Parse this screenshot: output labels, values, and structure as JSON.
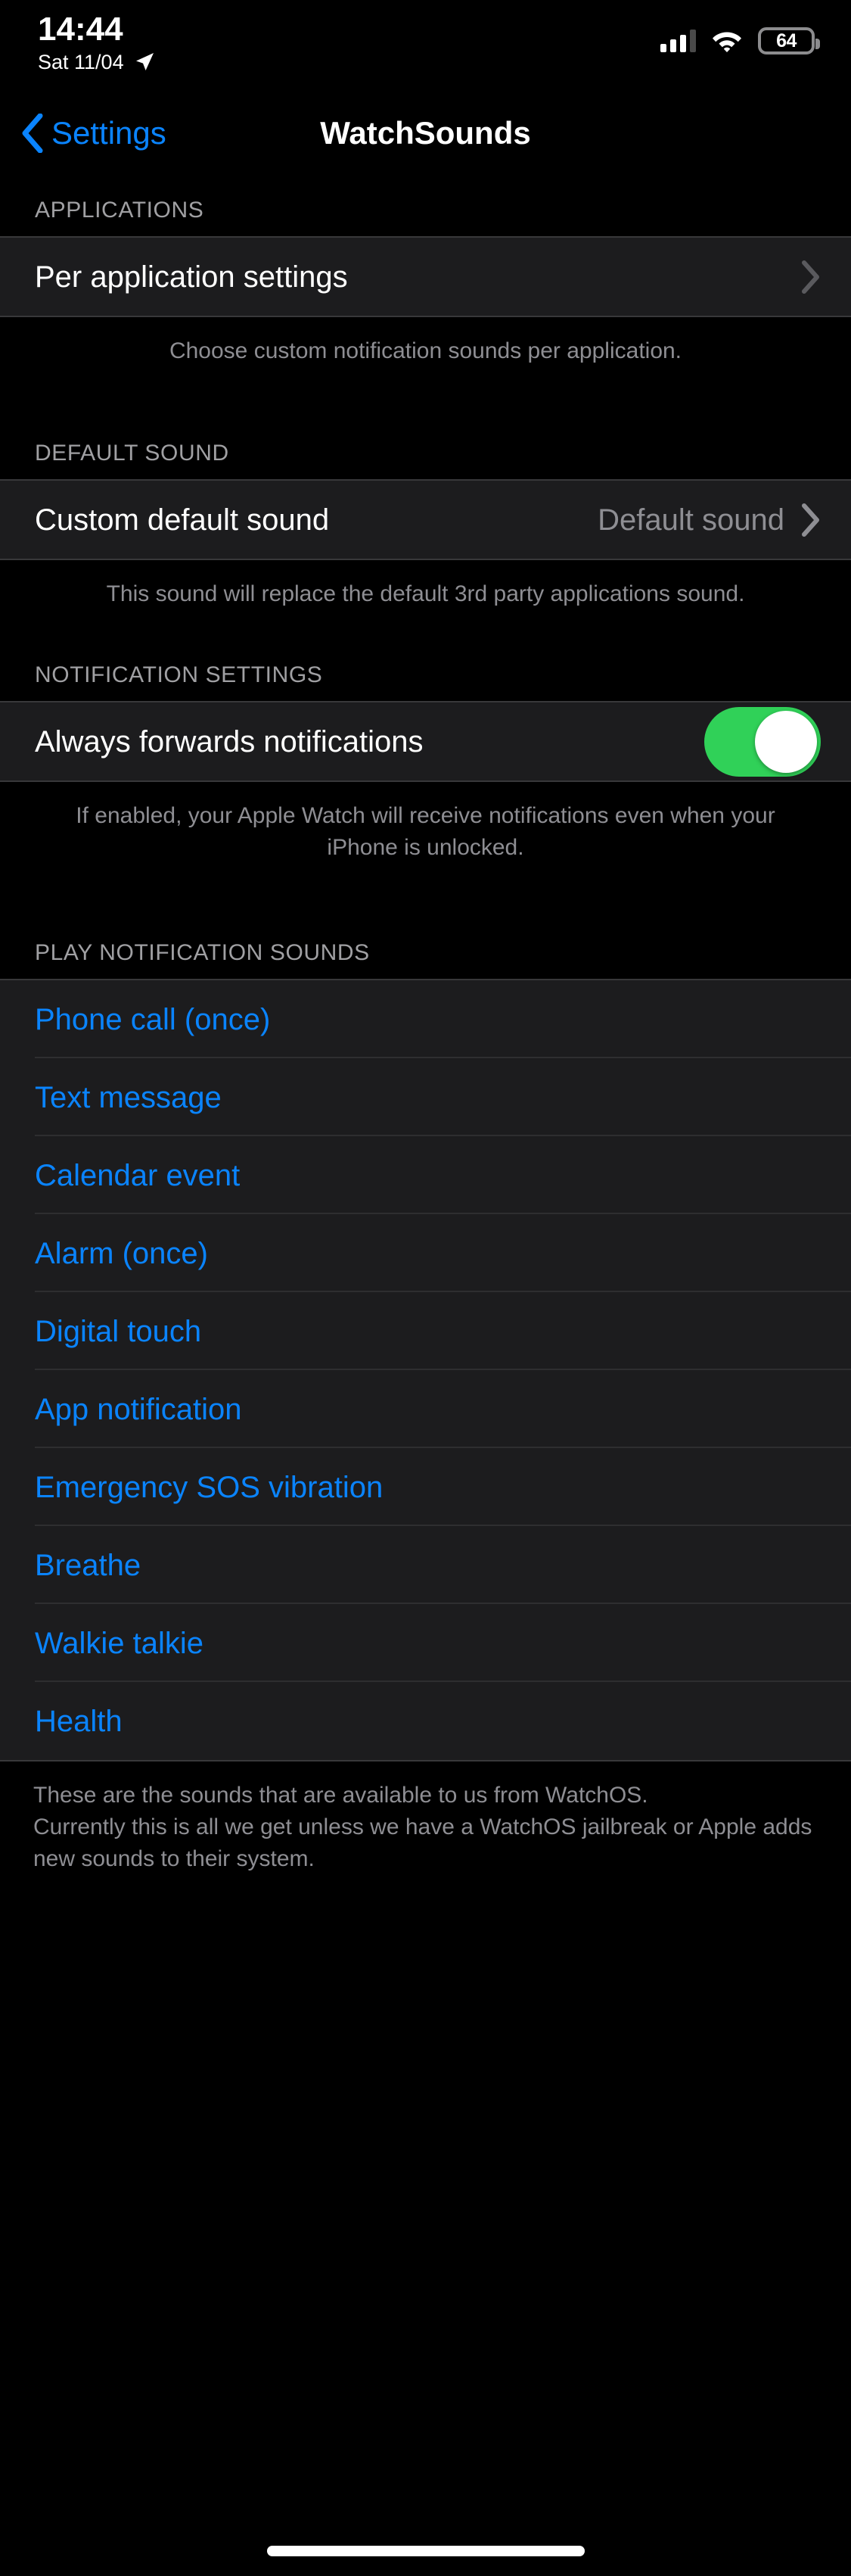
{
  "status_bar": {
    "time": "14:44",
    "date": "Sat 11/04",
    "location_icon": "location-arrow-icon",
    "cellular_icon": "cellular-signal-icon",
    "wifi_icon": "wifi-icon",
    "battery_percent": "64"
  },
  "nav": {
    "back_label": "Settings",
    "back_icon": "chevron-left-icon",
    "title": "WatchSounds"
  },
  "sections": {
    "applications": {
      "header": "APPLICATIONS",
      "row_label": "Per application settings",
      "footer": "Choose custom notification sounds per application."
    },
    "default_sound": {
      "header": "DEFAULT SOUND",
      "row_label": "Custom default sound",
      "row_value": "Default sound",
      "footer": "This sound will replace the default 3rd party applications sound."
    },
    "notification_settings": {
      "header": "NOTIFICATION SETTINGS",
      "row_label": "Always forwards notifications",
      "toggle_state": "on",
      "footer": "If enabled, your Apple Watch will receive notifications even when your iPhone is unlocked."
    },
    "play_notification_sounds": {
      "header": "PLAY NOTIFICATION SOUNDS",
      "items": [
        {
          "label": "Phone call (once)"
        },
        {
          "label": "Text message"
        },
        {
          "label": "Calendar event"
        },
        {
          "label": "Alarm (once)"
        },
        {
          "label": "Digital touch"
        },
        {
          "label": "App notification"
        },
        {
          "label": "Emergency SOS vibration"
        },
        {
          "label": "Breathe"
        },
        {
          "label": "Walkie talkie"
        },
        {
          "label": "Health"
        }
      ],
      "footer_line1": "These are the sounds that are available to us from WatchOS.",
      "footer_line2": "Currently this is all we get unless we have a WatchOS jailbreak or Apple adds new sounds to their system."
    }
  },
  "colors": {
    "accent_blue": "#0a84ff",
    "toggle_green": "#30d158",
    "row_background": "#1c1c1e",
    "page_background": "#000000",
    "secondary_text": "#8e8e93"
  }
}
